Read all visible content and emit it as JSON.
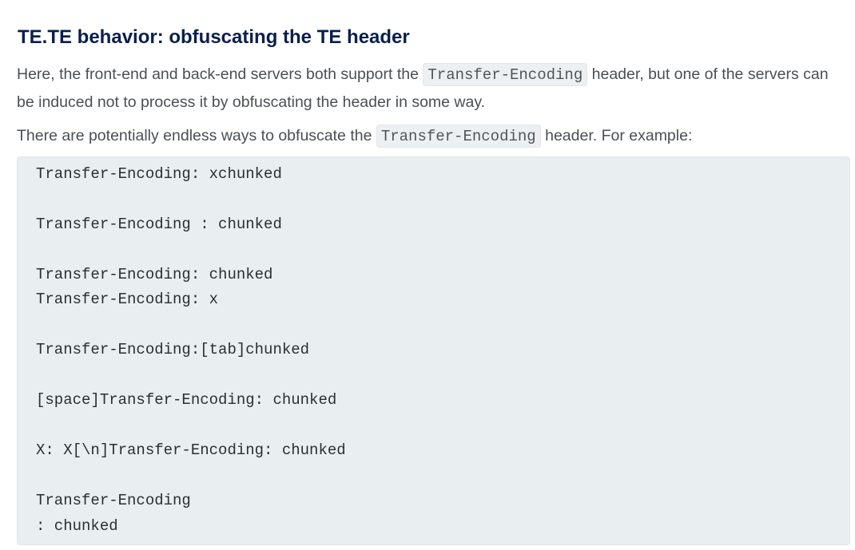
{
  "heading": "TE.TE behavior: obfuscating the TE header",
  "paragraph1": {
    "before": "Here, the front-end and back-end servers both support the ",
    "code": "Transfer-Encoding",
    "after": " header, but one of the servers can be induced not to process it by obfuscating the header in some way."
  },
  "paragraph2": {
    "before": "There are potentially endless ways to obfuscate the ",
    "code": "Transfer-Encoding",
    "after": " header. For example:"
  },
  "code_block": {
    "lines": [
      "Transfer-Encoding: xchunked",
      "Transfer-Encoding : chunked",
      "Transfer-Encoding: chunked",
      "Transfer-Encoding: x",
      "Transfer-Encoding:[tab]chunked",
      "[space]Transfer-Encoding: chunked",
      "X: X[\\n]Transfer-Encoding: chunked",
      "Transfer-Encoding",
      ": chunked"
    ]
  }
}
